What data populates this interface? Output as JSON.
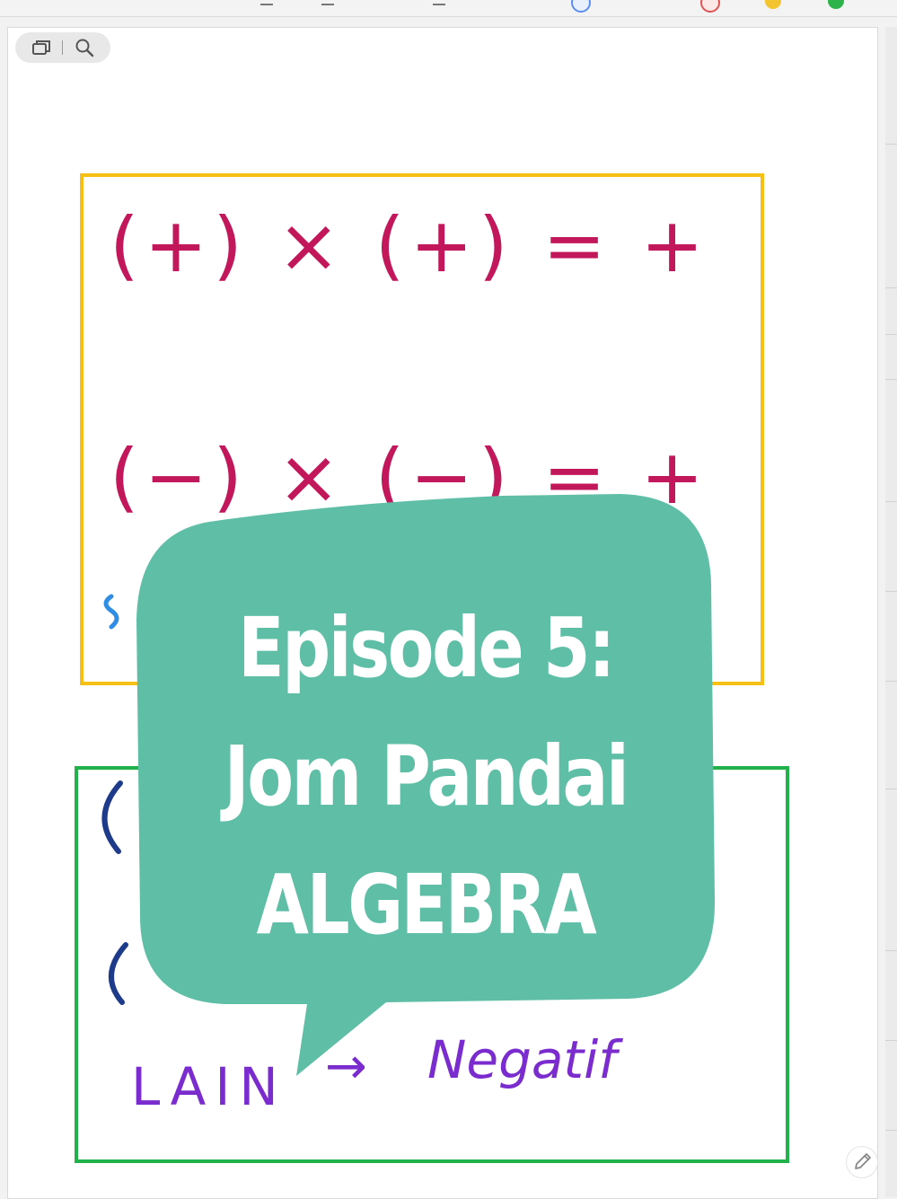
{
  "board": {
    "yellow_box": {
      "line1": "(+)  × (+) = +",
      "line2": "(−) × (−) = +"
    },
    "green_box": {
      "label": "LAIN",
      "arrow": "→",
      "result": "Negatif"
    }
  },
  "overlay": {
    "title_lines": [
      "Episode 5:",
      "Jom Pandai",
      "ALGEBRA"
    ],
    "bubble_color": "#5ebfa6"
  },
  "colors": {
    "ink_magenta": "#c2185b",
    "ink_purple": "#7b2ccf",
    "ink_navy": "#1e3a8a",
    "ink_blue": "#2f8de4",
    "box_yellow": "#f6c114",
    "box_green": "#21b24b"
  },
  "icons": {
    "tabs": "tabs-icon",
    "search": "search-icon",
    "pencil": "pencil-icon"
  }
}
